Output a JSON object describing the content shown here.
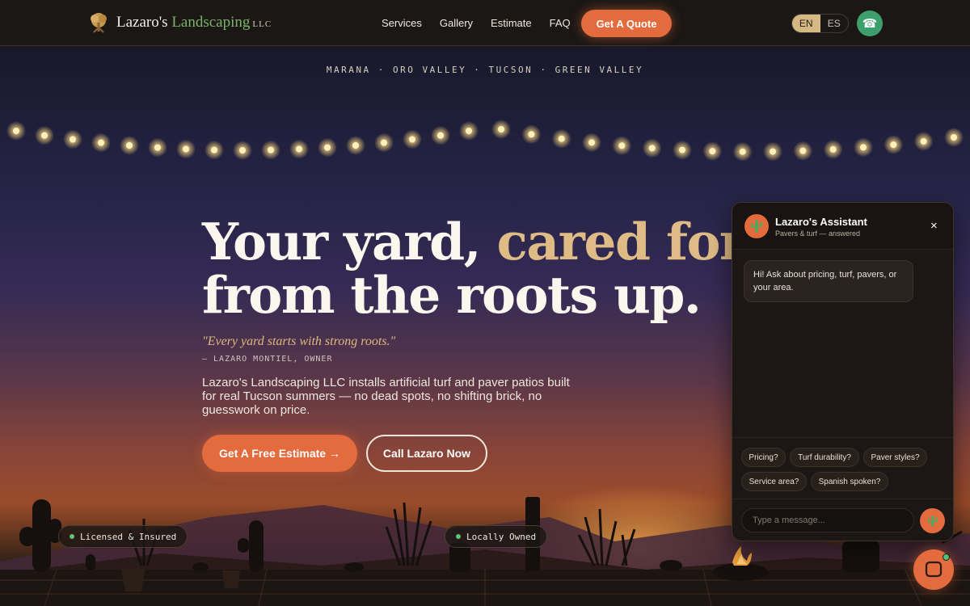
{
  "brand": {
    "name_part1": "Lazaro's",
    "name_part2": "Landscaping",
    "suffix": "LLC"
  },
  "nav": {
    "links": [
      "Services",
      "Gallery",
      "Estimate",
      "FAQ"
    ],
    "quote_button": "Get A Quote",
    "lang": {
      "en": "EN",
      "es": "ES",
      "active": "EN"
    },
    "phone_icon": "☎"
  },
  "hero": {
    "towns": "MARANA · ORO VALLEY · TUCSON · GREEN VALLEY",
    "headline_line1_a": "Your yard,",
    "headline_line1_b": "cared for",
    "headline_line2": "from the roots up.",
    "quote": "\"Every yard starts with strong roots.\"",
    "attribution": "— LAZARO MONTIEL, OWNER",
    "description": "Lazaro's Landscaping LLC installs artificial turf and paver patios built for real Tucson summers — no dead spots, no shifting brick, no guesswork on price.",
    "cta_primary": "Get A Free Estimate →",
    "cta_secondary": "Call Lazaro Now",
    "badges": [
      "Licensed & Insured",
      "Locally Owned"
    ]
  },
  "chat": {
    "title": "Lazaro's Assistant",
    "subtitle": "Pavers & turf — answered",
    "close_icon": "×",
    "greeting": "Hi! Ask about pricing, turf, pavers, or your area.",
    "chips": [
      "Pricing?",
      "Turf durability?",
      "Paver styles?",
      "Service area?",
      "Spanish spoken?"
    ],
    "input_placeholder": "Type a message..."
  },
  "colors": {
    "accent": "#e36b3e",
    "gold": "#dfbb85",
    "green": "#7ab36a",
    "online": "#4fc07a"
  }
}
